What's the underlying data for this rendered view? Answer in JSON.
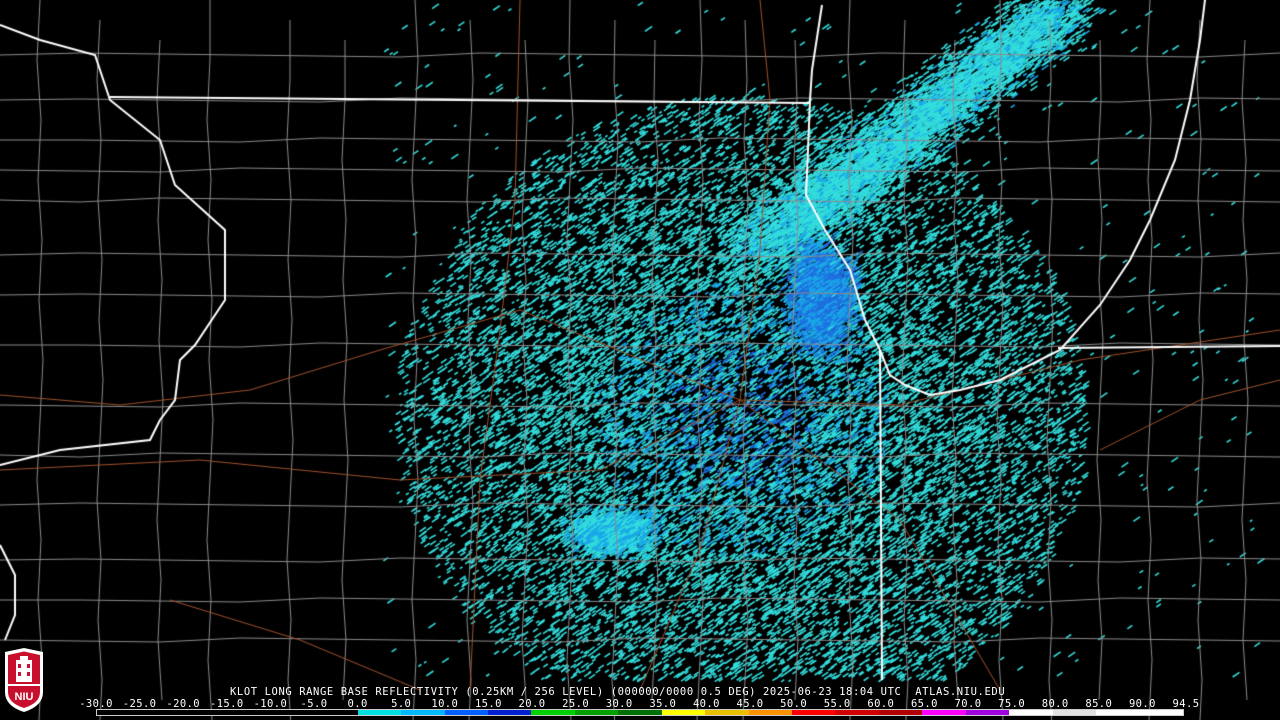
{
  "caption": {
    "radar_site": "KLOT",
    "product": "LONG RANGE BASE REFLECTIVITY",
    "resolution": "(0.25KM / 256 LEVEL)",
    "volume": "(000000/0000",
    "elevation": "0.5 DEG)",
    "timestamp": "2025-06-23 18:04 UTC",
    "source": "ATLAS.NIU.EDU"
  },
  "scale": {
    "labels": [
      "-30.0",
      "-25.0",
      "-20.0",
      "-15.0",
      "-10.0",
      "-5.0",
      "0.0",
      "5.0",
      "10.0",
      "15.0",
      "20.0",
      "25.0",
      "30.0",
      "35.0",
      "40.0",
      "45.0",
      "50.0",
      "55.0",
      "60.0",
      "65.0",
      "70.0",
      "75.0",
      "80.0",
      "85.0",
      "90.0",
      "94.5"
    ],
    "colors": [
      "#000000",
      "#000000",
      "#000000",
      "#000000",
      "#000000",
      "#000000",
      "#00e0e0",
      "#00b8ff",
      "#0060ff",
      "#0020d0",
      "#00d000",
      "#00a000",
      "#007000",
      "#ffff00",
      "#e8c000",
      "#ff9000",
      "#ff0000",
      "#d00000",
      "#b00000",
      "#ff00ff",
      "#a000e0",
      "#ffffff",
      "#e0e0e0",
      "#ffffff",
      "#ffffff"
    ]
  },
  "logo": {
    "text": "NIU",
    "color": "#c8102e"
  },
  "map_colors": {
    "background": "#000000",
    "state_border": "#ffffff",
    "county_border": "#8c8c8c",
    "highway": "#a0522d",
    "echo_light": "#33dddd",
    "echo_mid": "#1aa8e8",
    "echo_strong": "#1f6fe0"
  }
}
